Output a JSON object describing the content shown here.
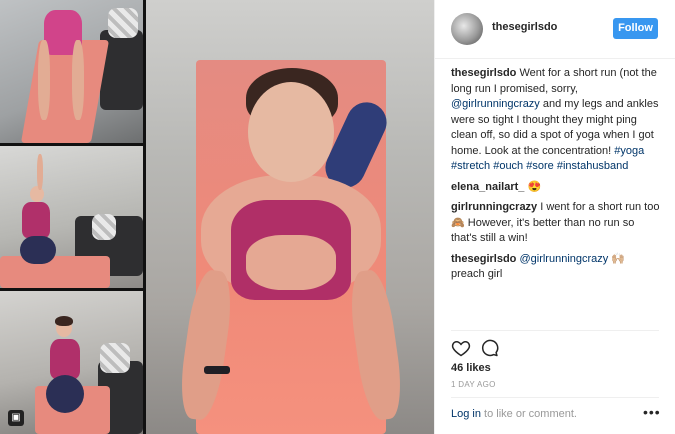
{
  "post": {
    "username": "thesegirlsdo",
    "follow_label": "Follow",
    "caption": {
      "user": "thesegirlsdo",
      "text_1": "Went for a short run (not the long run I promised, sorry,",
      "mention": "@girlrunningcrazy",
      "text_2": "and my legs and ankles were so tight I thought they might ping clean off, so did a spot of yoga when I got home. Look at the concentration!",
      "tags": [
        "#yoga",
        "#stretch",
        "#ouch",
        "#sore",
        "#instahusband"
      ]
    },
    "comments": [
      {
        "user": "elena_nailart_",
        "text": "😍"
      },
      {
        "user": "girlrunningcrazy",
        "text": "I went for a short run too 🙈 However, it's better than no run so that's still a win!"
      },
      {
        "user": "thesegirlsdo",
        "mention": "@girlrunningcrazy",
        "text": "🙌🏼 preach girl"
      }
    ],
    "likes": "46 likes",
    "date": "1 DAY AGO",
    "login_link": "Log in",
    "login_rest": "to like or comment.",
    "more": "•••"
  },
  "icons": [
    "heart-icon",
    "comment-icon",
    "multiple-photos-icon",
    "more-options-icon"
  ],
  "colors": {
    "accent": "#3897f0",
    "link": "#003569",
    "muted": "#999999"
  }
}
